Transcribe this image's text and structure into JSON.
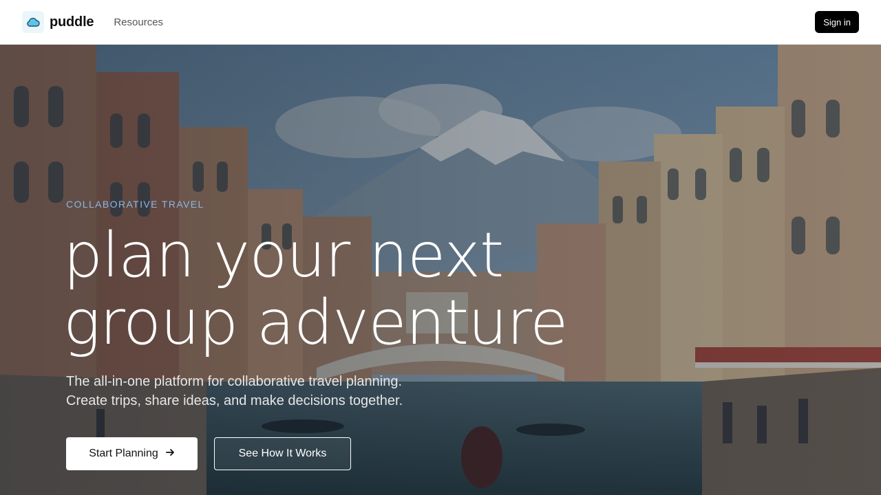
{
  "header": {
    "brand_name": "puddle",
    "logo_icon": "cloud-icon",
    "nav": [
      {
        "label": "Resources"
      }
    ],
    "signin_label": "Sign in"
  },
  "hero": {
    "eyebrow": "COLLABORATIVE TRAVEL",
    "headline_lines": [
      "plan your next",
      "group adventure"
    ],
    "subtitle_lines": [
      "The all-in-one platform for collaborative travel planning.",
      "Create trips, share ideas, and make decisions together."
    ],
    "primary_cta": {
      "label": "Start Planning",
      "icon": "arrow-right-icon"
    },
    "secondary_cta": {
      "label": "See How It Works"
    }
  },
  "colors": {
    "accent": "#8ab8e6",
    "button_dark": "#000000",
    "canal_water": "#2f4a56",
    "sky": "#8ea9bd"
  }
}
